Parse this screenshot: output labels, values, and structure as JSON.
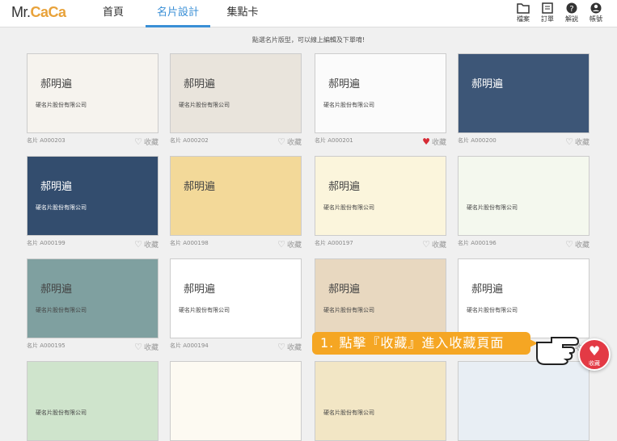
{
  "logo": {
    "prefix": "Mr.",
    "name": "CaCa"
  },
  "nav": {
    "home": "首頁",
    "design": "名片設計",
    "points": "集點卡"
  },
  "tools": [
    {
      "label": "檔案",
      "icon": "folder-icon"
    },
    {
      "label": "訂單",
      "icon": "order-icon"
    },
    {
      "label": "解説",
      "icon": "help-icon"
    },
    {
      "label": "帳號",
      "icon": "account-icon"
    }
  ],
  "hint": "點選名片版型，可以線上編輯及下單唷!",
  "fav_label": "收藏",
  "cards": [
    {
      "code": "名片 A000203",
      "fav": false,
      "name": "郝明遍",
      "company": "硬名片股份有限公司"
    },
    {
      "code": "名片 A000202",
      "fav": false,
      "name": "郝明遍",
      "company": "硬名片股份有限公司"
    },
    {
      "code": "名片 A000201",
      "fav": true,
      "name": "郝明遍",
      "company": "硬名片股份有限公司"
    },
    {
      "code": "名片 A000200",
      "fav": false,
      "name": "郝明遍",
      "company": ""
    },
    {
      "code": "名片 A000199",
      "fav": false,
      "name": "郝明遍",
      "company": "硬名片股份有限公司"
    },
    {
      "code": "名片 A000198",
      "fav": false,
      "name": "郝明遍",
      "company": ""
    },
    {
      "code": "名片 A000197",
      "fav": false,
      "name": "郝明遍",
      "company": "硬名片股份有限公司"
    },
    {
      "code": "名片 A000196",
      "fav": false,
      "name": "",
      "company": "硬名片股份有限公司"
    },
    {
      "code": "名片 A000195",
      "fav": false,
      "name": "郝明遍",
      "company": "硬名片股份有限公司"
    },
    {
      "code": "名片 A000194",
      "fav": false,
      "name": "郝明遍",
      "company": "硬名片股份有限公司"
    },
    {
      "code": "名片 A000193",
      "fav": false,
      "name": "郝明遍",
      "company": "硬名片股份有限公司"
    },
    {
      "code": "名片 A000192",
      "fav": false,
      "name": "郝明遍",
      "company": "硬名片股份有限公司"
    },
    {
      "code": "",
      "fav": false,
      "name": "",
      "company": "硬名片股份有限公司"
    },
    {
      "code": "",
      "fav": false,
      "name": "",
      "company": ""
    },
    {
      "code": "",
      "fav": false,
      "name": "",
      "company": "硬名片股份有限公司"
    },
    {
      "code": "",
      "fav": false,
      "name": "",
      "company": ""
    }
  ],
  "tip": "1. 點擊『收藏』進入收藏頁面",
  "fab_label": "收藏",
  "card_designs": [
    "#f6f3ee",
    "#e9e4dc",
    "#fbfbfb",
    "#3d5677",
    "#334d6e",
    "#f3d999",
    "#fbf5dc",
    "#f4f8ee",
    "#7fa0a0",
    "#ffffff",
    "#e8d8c0",
    "#ffffff",
    "#cfe4cc",
    "#fdfaf2",
    "#f2e6c5",
    "#e8eef4"
  ]
}
